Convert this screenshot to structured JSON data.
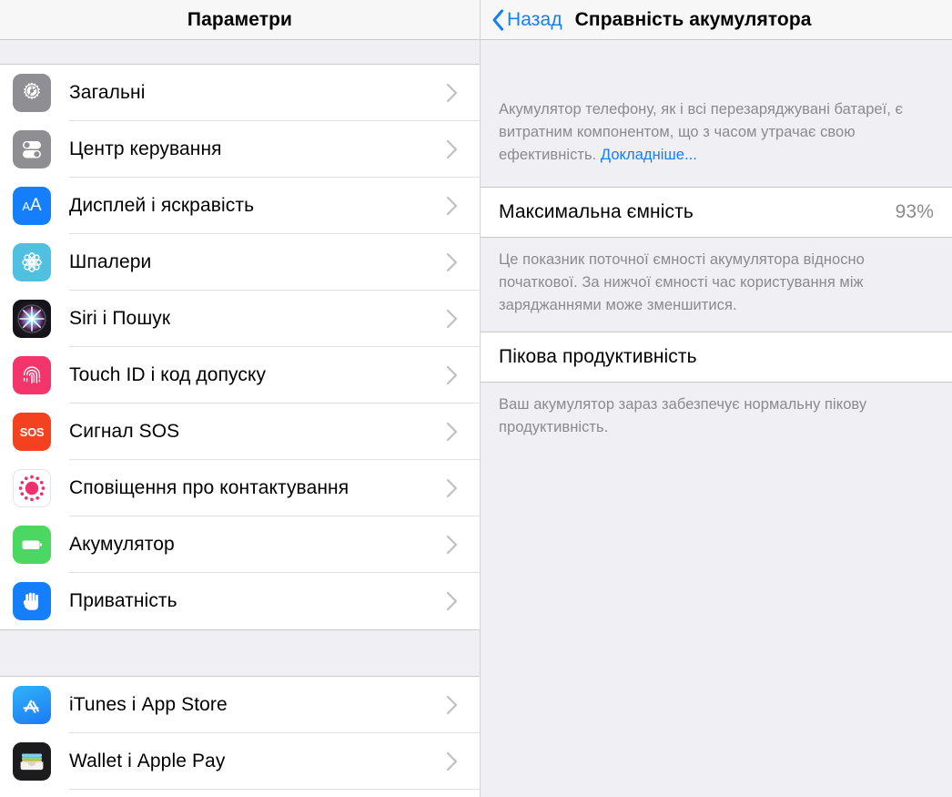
{
  "left": {
    "header": {
      "title": "Параметри"
    },
    "groups": [
      {
        "items": [
          {
            "label": "Загальні",
            "icon": "gear-icon",
            "icon_class": "ic-general"
          },
          {
            "label": "Центр керування",
            "icon": "control-center-icon",
            "icon_class": "ic-control"
          },
          {
            "label": "Дисплей і яскравість",
            "icon": "display-brightness-icon",
            "icon_class": "ic-display"
          },
          {
            "label": "Шпалери",
            "icon": "wallpaper-icon",
            "icon_class": "ic-wallpaper"
          },
          {
            "label": "Siri і Пошук",
            "icon": "siri-icon",
            "icon_class": "ic-siri"
          },
          {
            "label": "Touch ID і код допуску",
            "icon": "fingerprint-icon",
            "icon_class": "ic-touchid"
          },
          {
            "label": "Сигнал SOS",
            "icon": "sos-icon",
            "icon_class": "ic-sos"
          },
          {
            "label": "Сповіщення про контактування",
            "icon": "exposure-notifications-icon",
            "icon_class": "ic-emergency"
          },
          {
            "label": "Акумулятор",
            "icon": "battery-icon",
            "icon_class": "ic-battery"
          },
          {
            "label": "Приватність",
            "icon": "hand-privacy-icon",
            "icon_class": "ic-privacy"
          }
        ]
      },
      {
        "items": [
          {
            "label": "iTunes і App Store",
            "icon": "app-store-icon",
            "icon_class": "ic-appstore"
          },
          {
            "label": "Wallet і Apple Pay",
            "icon": "wallet-icon",
            "icon_class": "ic-wallet"
          }
        ]
      }
    ]
  },
  "right": {
    "header": {
      "back_label": "Назад",
      "title": "Справність акумулятора"
    },
    "intro_note_prefix": "Акумулятор телефону, як і всі перезаряджувані батареї, є витратним компонентом, що з часом утрачає свою ефективність. ",
    "intro_note_link": "Докладніше...",
    "capacity_row": {
      "label": "Максимальна ємність",
      "value": "93%"
    },
    "capacity_note": "Це показник поточної ємності акумулятора відносно початкової. За нижчої ємності час користування між заряджаннями може зменшитися.",
    "performance_row": {
      "label": "Пікова продуктивність"
    },
    "performance_note": "Ваш акумулятор зараз забезпечує нормальну пікову продуктивність."
  },
  "colors": {
    "accent_blue": "#147efb",
    "panel_gray": "#efeff4",
    "secondary_text": "#8a8a8f",
    "separator": "#c9c9cc"
  }
}
